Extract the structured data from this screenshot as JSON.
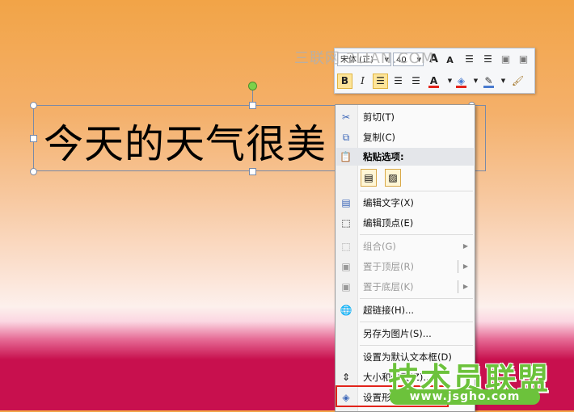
{
  "slide": {
    "textbox_text": "今天的天气很美"
  },
  "watermark": {
    "text": "三联网 3LIAN.COM"
  },
  "mini_toolbar": {
    "font_name": "宋体 (正)",
    "font_size": "40",
    "grow_font_label": "A",
    "shrink_font_label": "A",
    "bold_label": "B",
    "italic_label": "I",
    "font_color_label": "A",
    "font_color": "#e3231b",
    "highlight_color": "#e3231b"
  },
  "context_menu": {
    "cut": "剪切(T)",
    "copy": "复制(C)",
    "paste_options": "粘贴选项:",
    "edit_text": "编辑文字(X)",
    "edit_points": "编辑顶点(E)",
    "group": "组合(G)",
    "bring_to_front": "置于顶层(R)",
    "send_to_back": "置于底层(K)",
    "hyperlink": "超链接(H)...",
    "save_as_picture": "另存为图片(S)...",
    "set_default_textbox": "设置为默认文本框(D)",
    "size_and_position": "大小和位置(Z)...",
    "format_shape": "设置形状格式(O)..."
  },
  "logo": {
    "text": "技术员联盟",
    "url": "www.jsgho.com",
    "color": "#6cc23b"
  }
}
